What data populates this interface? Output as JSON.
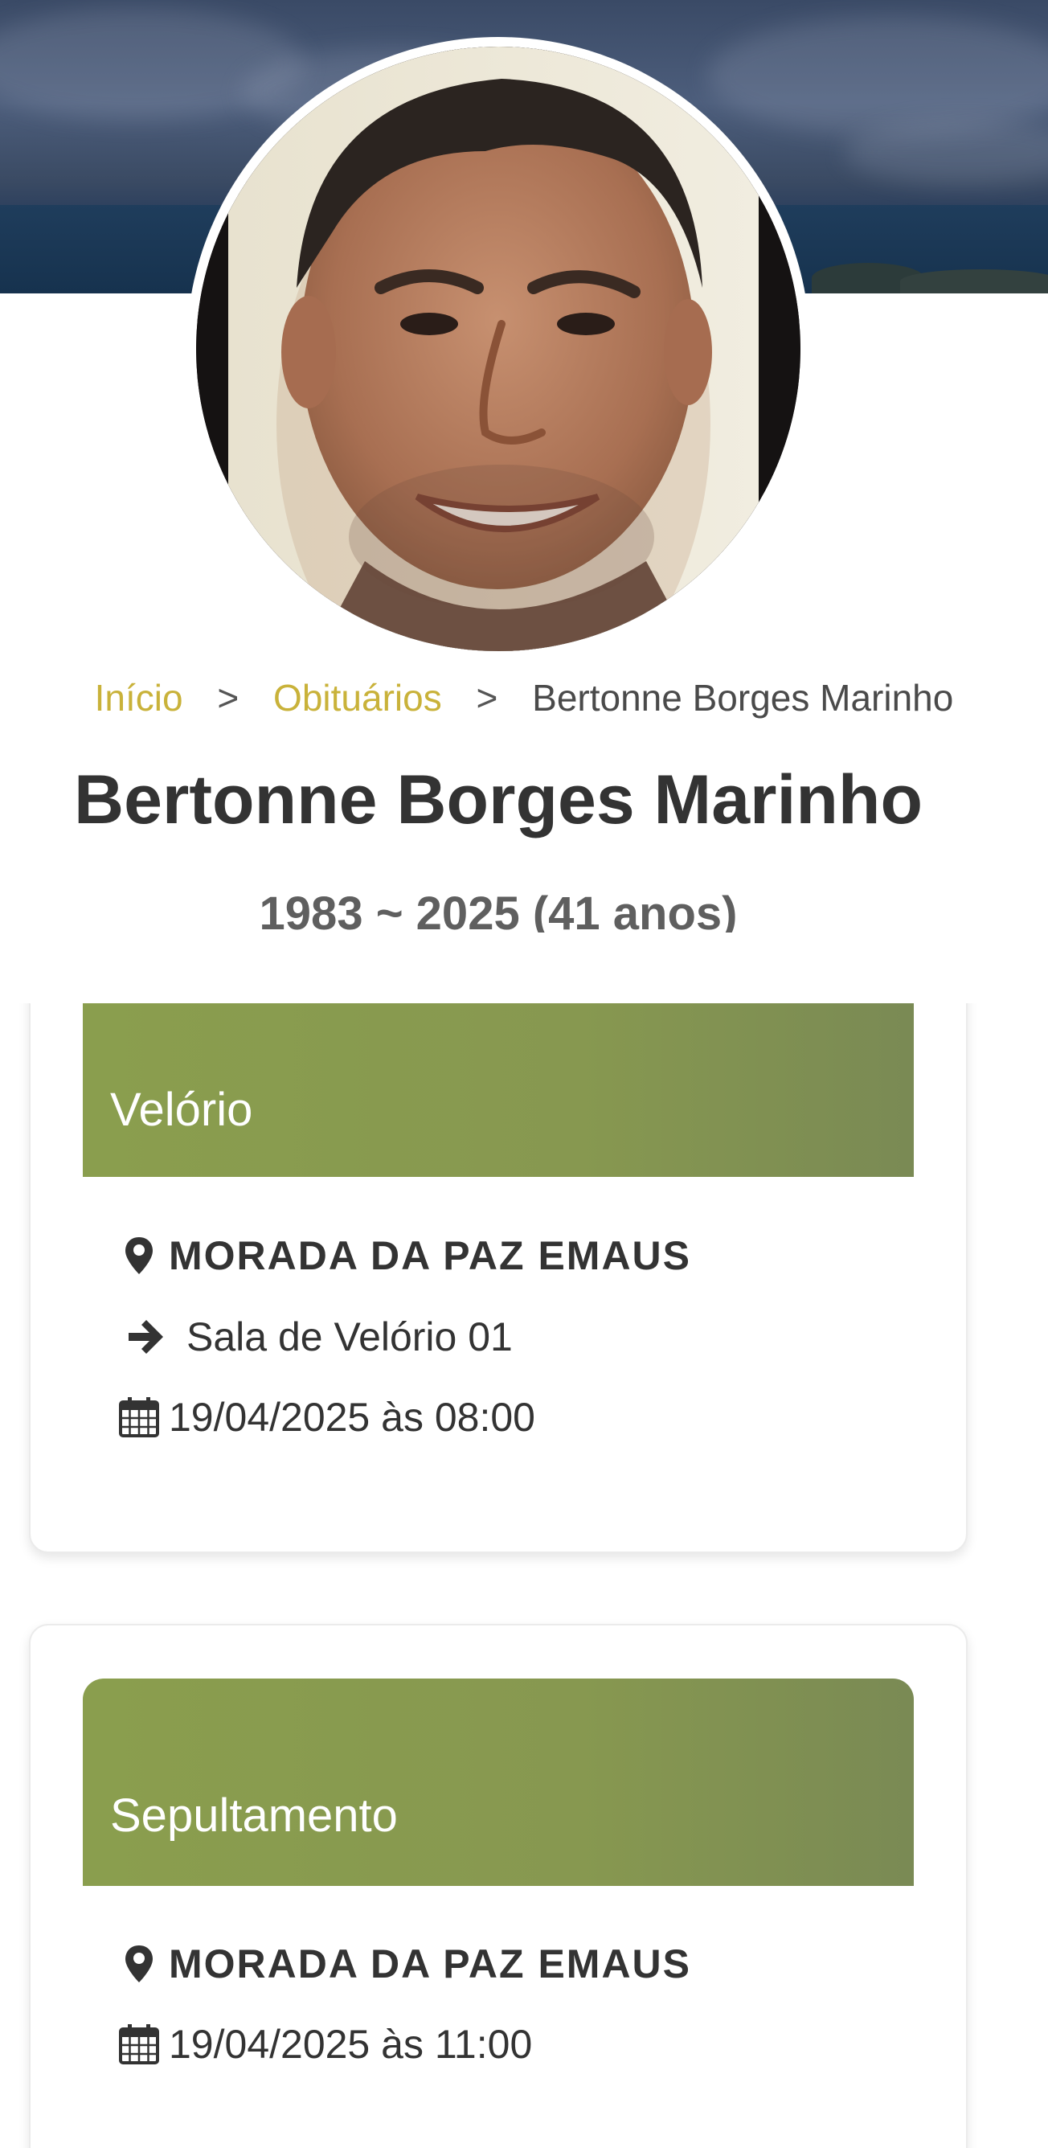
{
  "breadcrumb": {
    "home": "Início",
    "separator": ">",
    "section": "Obituários",
    "current": "Bertonne Borges Marinho"
  },
  "profile": {
    "name": "Bertonne Borges Marinho",
    "life_span": "1983 ~ 2025 (41 anos)",
    "photo_icon": "person-photo"
  },
  "events": [
    {
      "title": "Velório",
      "location": "MORADA DA PAZ EMAUS",
      "room": "Sala de Velório 01",
      "datetime": "19/04/2025 às 08:00"
    },
    {
      "title": "Sepultamento",
      "location": "MORADA DA PAZ EMAUS",
      "datetime": "19/04/2025 às 11:00"
    }
  ],
  "icons": {
    "location": "map-pin-icon",
    "room": "arrow-right-icon",
    "date": "calendar-icon"
  },
  "colors": {
    "accent_link": "#c9b23a",
    "event_header": "#8a9e4e",
    "text_dark": "#333333",
    "text_muted": "#5f5f5f"
  }
}
